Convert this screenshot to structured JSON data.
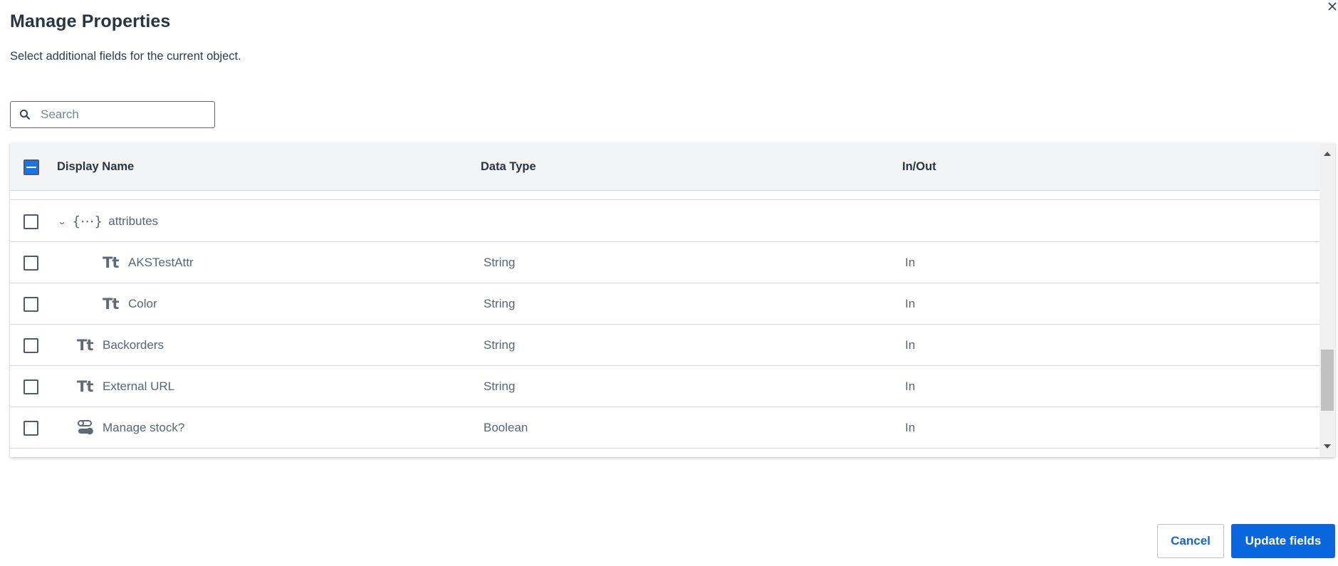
{
  "dialog": {
    "title": "Manage Properties",
    "subtitle": "Select additional fields for the current object.",
    "close_icon": "close-icon"
  },
  "search": {
    "placeholder": "Search",
    "value": "",
    "icon": "search-icon"
  },
  "table": {
    "select_all_state": "indeterminate",
    "columns": [
      "Display Name",
      "Data Type",
      "In/Out"
    ],
    "rows": [
      {
        "name": "attributes",
        "type": "",
        "io": "",
        "icon": "object-braces-icon",
        "expanded": true,
        "level": 0,
        "checked": false
      },
      {
        "name": "AKSTestAttr",
        "type": "String",
        "io": "In",
        "icon": "text-type-icon",
        "level": 1,
        "checked": false
      },
      {
        "name": "Color",
        "type": "String",
        "io": "In",
        "icon": "text-type-icon",
        "level": 1,
        "checked": false
      },
      {
        "name": "Backorders",
        "type": "String",
        "io": "In",
        "icon": "text-type-icon",
        "level": 0,
        "checked": false
      },
      {
        "name": "External URL",
        "type": "String",
        "io": "In",
        "icon": "text-type-icon",
        "level": 0,
        "checked": false
      },
      {
        "name": "Manage stock?",
        "type": "Boolean",
        "io": "In",
        "icon": "toggle-boolean-icon",
        "level": 0,
        "checked": false
      }
    ],
    "icons": {
      "text_type_glyph": "Tt",
      "object_glyph": "{⋯}",
      "chevron_glyph": "⌄"
    }
  },
  "footer": {
    "cancel_label": "Cancel",
    "update_label": "Update fields"
  },
  "colors": {
    "primary": "#0a66dd",
    "header_bg": "#f3f4f6",
    "checkbox_indeterminate": "#1a73e8"
  }
}
